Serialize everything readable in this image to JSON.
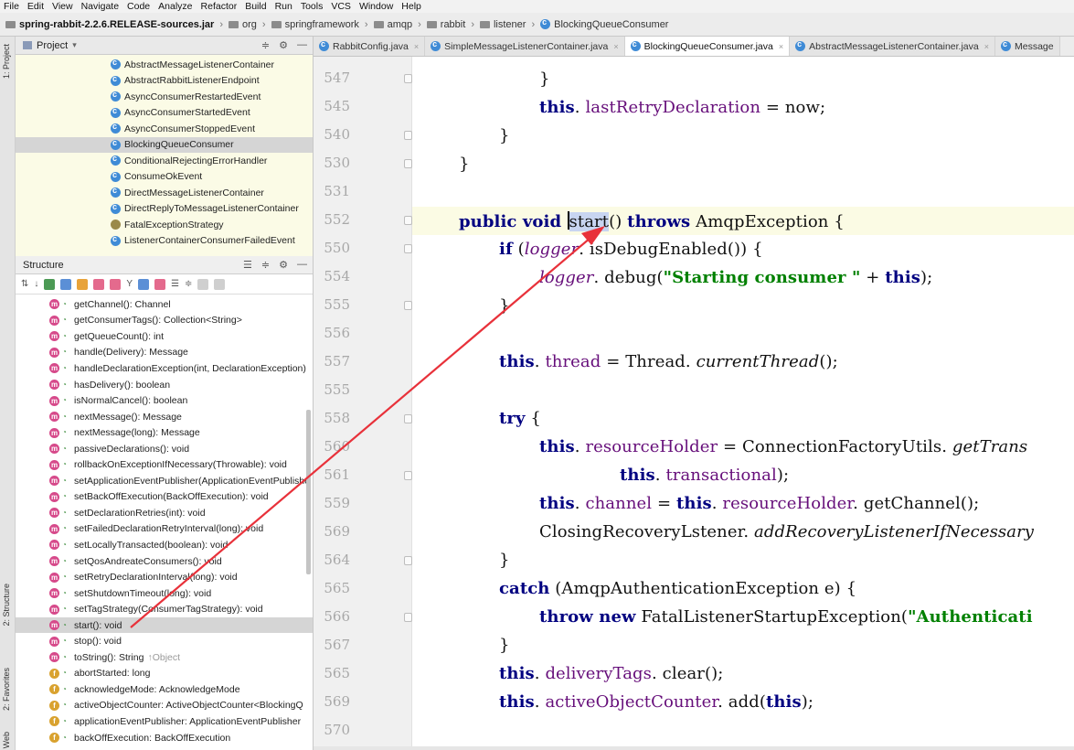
{
  "menu": [
    "File",
    "Edit",
    "View",
    "Navigate",
    "Code",
    "Analyze",
    "Refactor",
    "Build",
    "Run",
    "Tools",
    "VCS",
    "Window",
    "Help"
  ],
  "breadcrumb": {
    "jar": "spring-rabbit-2.2.6.RELEASE-sources.jar",
    "parts": [
      "org",
      "springframework",
      "amqp",
      "rabbit",
      "listener"
    ],
    "current": "BlockingQueueConsumer"
  },
  "side_labels": {
    "project": "1: Project",
    "structure": "2: Structure",
    "favorites": "2: Favorites",
    "web": "Web"
  },
  "project_panel": {
    "title": "Project",
    "items": [
      "AbstractMessageListenerContainer",
      "AbstractRabbitListenerEndpoint",
      "AsyncConsumerRestartedEvent",
      "AsyncConsumerStartedEvent",
      "AsyncConsumerStoppedEvent",
      "BlockingQueueConsumer",
      "ConditionalRejectingErrorHandler",
      "ConsumeOkEvent",
      "DirectMessageListenerContainer",
      "DirectReplyToMessageListenerContainer",
      "FatalExceptionStrategy",
      "ListenerContainerConsumerFailedEvent"
    ],
    "selected_index": 5
  },
  "structure_panel": {
    "title": "Structure",
    "items": [
      {
        "kind": "m",
        "text": "getChannel(): Channel"
      },
      {
        "kind": "m",
        "text": "getConsumerTags(): Collection<String>"
      },
      {
        "kind": "m",
        "text": "getQueueCount(): int"
      },
      {
        "kind": "m",
        "text": "handle(Delivery): Message"
      },
      {
        "kind": "m",
        "text": "handleDeclarationException(int, DeclarationException)"
      },
      {
        "kind": "m",
        "text": "hasDelivery(): boolean"
      },
      {
        "kind": "m",
        "text": "isNormalCancel(): boolean"
      },
      {
        "kind": "m",
        "text": "nextMessage(): Message"
      },
      {
        "kind": "m",
        "text": "nextMessage(long): Message"
      },
      {
        "kind": "m",
        "text": "passiveDeclarations(): void"
      },
      {
        "kind": "m",
        "text": "rollbackOnExceptionIfNecessary(Throwable): void"
      },
      {
        "kind": "m",
        "text": "setApplicationEventPublisher(ApplicationEventPublishe"
      },
      {
        "kind": "m",
        "text": "setBackOffExecution(BackOffExecution): void"
      },
      {
        "kind": "m",
        "text": "setDeclarationRetries(int): void"
      },
      {
        "kind": "m",
        "text": "setFailedDeclarationRetryInterval(long): void"
      },
      {
        "kind": "m",
        "text": "setLocallyTransacted(boolean): void"
      },
      {
        "kind": "m",
        "text": "setQosAndreateConsumers(): void"
      },
      {
        "kind": "m",
        "text": "setRetryDeclarationInterval(long): void"
      },
      {
        "kind": "m",
        "text": "setShutdownTimeout(long): void"
      },
      {
        "kind": "m",
        "text": "setTagStrategy(ConsumerTagStrategy): void"
      },
      {
        "kind": "m",
        "text": "start(): void"
      },
      {
        "kind": "m",
        "text": "stop(): void"
      },
      {
        "kind": "m",
        "text": "toString(): String",
        "inherit": "↑Object"
      },
      {
        "kind": "f",
        "text": "abortStarted: long"
      },
      {
        "kind": "f",
        "text": "acknowledgeMode: AcknowledgeMode"
      },
      {
        "kind": "f",
        "text": "activeObjectCounter: ActiveObjectCounter<BlockingQ"
      },
      {
        "kind": "f",
        "text": "applicationEventPublisher: ApplicationEventPublisher"
      },
      {
        "kind": "f",
        "text": "backOffExecution: BackOffExecution"
      }
    ],
    "selected_index": 20
  },
  "tabs": [
    {
      "label": "RabbitConfig.java",
      "active": false
    },
    {
      "label": "SimpleMessageListenerContainer.java",
      "active": false
    },
    {
      "label": "BlockingQueueConsumer.java",
      "active": true
    },
    {
      "label": "AbstractMessageListenerContainer.java",
      "active": false
    },
    {
      "label": "Message",
      "active": false
    }
  ],
  "gutter_lines": [
    "547",
    "545",
    "540",
    "530",
    "531",
    "552",
    "550",
    "554",
    "555",
    "556",
    "557",
    "555",
    "558",
    "560",
    "561",
    "559",
    "569",
    "564",
    "565",
    "566",
    "567",
    "565",
    "569",
    "570"
  ],
  "code": {
    "l547": "}",
    "l545_a": "this",
    "l545_b": ". ",
    "l545_c": "lastRetryDeclaration",
    "l545_d": " = now;",
    "l540": "}",
    "l530": "}",
    "l552_a": "public void ",
    "l552_b": "start",
    "l552_c": "() ",
    "l552_d": "throws",
    "l552_e": " AmqpException {",
    "l550_a": "if",
    "l550_b": " (",
    "l550_c": "logger",
    "l550_d": ". isDebugEnabled()) {",
    "l554_a": "logger",
    "l554_b": ". debug(",
    "l554_c": "\"Starting consumer \"",
    "l554_d": " + ",
    "l554_e": "this",
    "l554_f": ");",
    "l555": "}",
    "l557_a": "this",
    "l557_b": ". ",
    "l557_c": "thread",
    "l557_d": " = Thread. ",
    "l557_e": "currentThread",
    "l557_f": "();",
    "l558_a": "try",
    "l558_b": " {",
    "l560_a": "this",
    "l560_b": ". ",
    "l560_c": "resourceHolder",
    "l560_d": " = ConnectionFactoryUtils. ",
    "l560_e": "getTrans",
    "l561_a": "this",
    "l561_b": ". ",
    "l561_c": "transactional",
    "l561_d": ");",
    "l559_a": "this",
    "l559_b": ". ",
    "l559_c": "channel",
    "l559_d": " = ",
    "l559_e": "this",
    "l559_f": ". ",
    "l559_g": "resourceHolder",
    "l559_h": ". getChannel();",
    "l569_a": "ClosingRecoveryL",
    "l569_b": "stener. ",
    "l569_c": "addRecoveryListenerIfNecessary",
    "l564": "}",
    "l565_a": "catch",
    "l565_b": " (AmqpAuthenticationException e) {",
    "l566_a": "throw new",
    "l566_b": " FatalListenerStartupException(",
    "l566_c": "\"Authenticati",
    "l567": "}",
    "l565b_a": "this",
    "l565b_b": ". ",
    "l565b_c": "deliveryTags",
    "l565b_d": ". clear();",
    "l569b_a": "this",
    "l569b_b": ". ",
    "l569b_c": "activeObjectCounter",
    "l569b_d": ". add(",
    "l569b_e": "this",
    "l569b_f": ");"
  },
  "colors": {
    "annotation_arrow": "#e8313a",
    "keyword": "#000080",
    "field": "#660e7a",
    "string": "#008000"
  }
}
